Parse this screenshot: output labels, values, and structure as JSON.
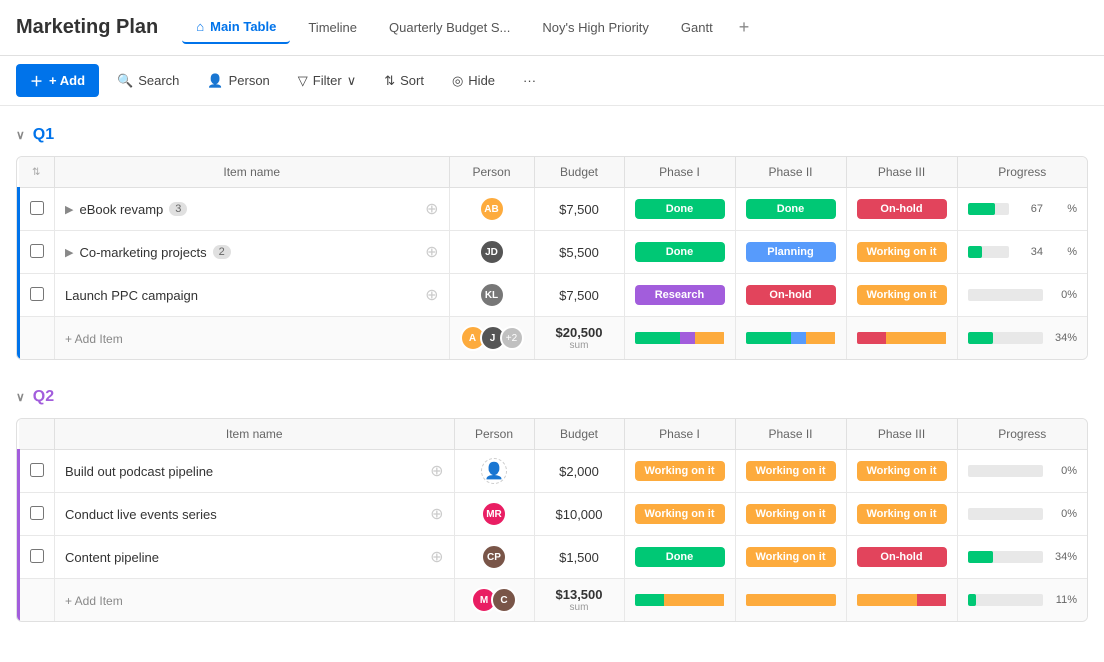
{
  "app": {
    "title": "Marketing Plan"
  },
  "tabs": [
    {
      "id": "main-table",
      "label": "Main Table",
      "icon": "🏠",
      "active": true
    },
    {
      "id": "timeline",
      "label": "Timeline",
      "active": false
    },
    {
      "id": "quarterly-budget",
      "label": "Quarterly Budget S...",
      "active": false
    },
    {
      "id": "noys-high-priority",
      "label": "Noy's High Priority",
      "active": false
    },
    {
      "id": "gantt",
      "label": "Gantt",
      "active": false
    }
  ],
  "toolbar": {
    "add_label": "+ Add",
    "search_label": "Search",
    "person_label": "Person",
    "filter_label": "Filter",
    "sort_label": "Sort",
    "hide_label": "Hide"
  },
  "groups": [
    {
      "id": "q1",
      "label": "Q1",
      "color": "#0073ea",
      "columns": {
        "item_name": "Item name",
        "person": "Person",
        "budget": "Budget",
        "phase1": "Phase I",
        "phase2": "Phase II",
        "phase3": "Phase III",
        "progress": "Progress"
      },
      "rows": [
        {
          "name": "eBook revamp",
          "sub_count": "3",
          "avatar_color": "#fdab3d",
          "avatar_initials": "AB",
          "budget": "$7,500",
          "phase1": "Done",
          "phase1_class": "phase-done",
          "phase2": "Done",
          "phase2_class": "phase-done",
          "phase3": "On-hold",
          "phase3_class": "phase-onhold",
          "progress": 67
        },
        {
          "name": "Co-marketing projects",
          "sub_count": "2",
          "avatar_color": "#333",
          "avatar_initials": "JD",
          "budget": "$5,500",
          "phase1": "Done",
          "phase1_class": "phase-done",
          "phase2": "Planning",
          "phase2_class": "phase-planning",
          "phase3": "Working on it",
          "phase3_class": "phase-working",
          "progress": 34
        },
        {
          "name": "Launch PPC campaign",
          "sub_count": "",
          "avatar_color": "#555",
          "avatar_initials": "KL",
          "budget": "$7,500",
          "phase1": "Research",
          "phase1_class": "phase-research",
          "phase2": "On-hold",
          "phase2_class": "phase-onhold",
          "phase3": "Working on it",
          "phase3_class": "phase-working",
          "progress": 0
        }
      ],
      "summary": {
        "budget": "$20,500",
        "budget_sum_label": "sum",
        "progress": 34
      },
      "add_item_label": "+ Add Item"
    },
    {
      "id": "q2",
      "label": "Q2",
      "color": "#a25ddc",
      "columns": {
        "item_name": "Item name",
        "person": "Person",
        "budget": "Budget",
        "phase1": "Phase I",
        "phase2": "Phase II",
        "phase3": "Phase III",
        "progress": "Progress"
      },
      "rows": [
        {
          "name": "Build out podcast pipeline",
          "sub_count": "",
          "avatar_color": "#ccc",
          "avatar_initials": "",
          "empty_avatar": true,
          "budget": "$2,000",
          "phase1": "Working on it",
          "phase1_class": "phase-working",
          "phase2": "Working on it",
          "phase2_class": "phase-working",
          "phase3": "Working on it",
          "phase3_class": "phase-working",
          "progress": 0
        },
        {
          "name": "Conduct live events series",
          "sub_count": "",
          "avatar_color": "#e91e63",
          "avatar_initials": "MR",
          "budget": "$10,000",
          "phase1": "Working on it",
          "phase1_class": "phase-working",
          "phase2": "Working on it",
          "phase2_class": "phase-working",
          "phase3": "Working on it",
          "phase3_class": "phase-working",
          "progress": 0
        },
        {
          "name": "Content pipeline",
          "sub_count": "",
          "avatar_color": "#795548",
          "avatar_initials": "CP",
          "budget": "$1,500",
          "phase1": "Done",
          "phase1_class": "phase-done",
          "phase2": "Working on it",
          "phase2_class": "phase-working",
          "phase3": "On-hold",
          "phase3_class": "phase-onhold",
          "progress": 34
        }
      ],
      "summary": {
        "budget": "$13,500",
        "budget_sum_label": "sum",
        "progress": 11
      },
      "add_item_label": "+ Add Item"
    }
  ]
}
